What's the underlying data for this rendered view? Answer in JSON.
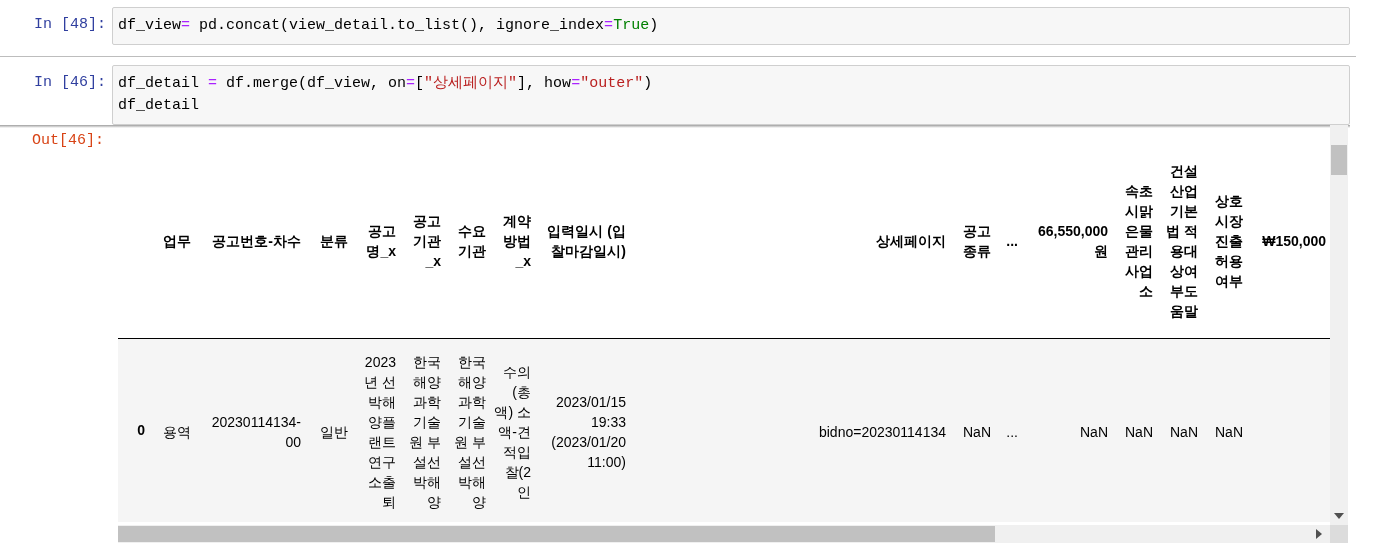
{
  "cells": [
    {
      "prompt": "In [48]:",
      "lines": [
        [
          {
            "kind": "plain",
            "text": "df_view"
          },
          {
            "kind": "operator",
            "text": "="
          },
          {
            "kind": "plain",
            "text": " pd.concat(view_detail.to_list(), ignore_index"
          },
          {
            "kind": "operator",
            "text": "="
          },
          {
            "kind": "keyword",
            "text": "True"
          },
          {
            "kind": "plain",
            "text": ")"
          }
        ]
      ]
    },
    {
      "prompt": "In [46]:",
      "lines": [
        [
          {
            "kind": "plain",
            "text": "df_detail "
          },
          {
            "kind": "operator",
            "text": "="
          },
          {
            "kind": "plain",
            "text": " df.merge(df_view, on"
          },
          {
            "kind": "operator",
            "text": "="
          },
          {
            "kind": "plain",
            "text": "["
          },
          {
            "kind": "string",
            "text": "\"상세페이지\""
          },
          {
            "kind": "plain",
            "text": "], how"
          },
          {
            "kind": "operator",
            "text": "="
          },
          {
            "kind": "string",
            "text": "\"outer\""
          },
          {
            "kind": "plain",
            "text": ")"
          }
        ],
        [
          {
            "kind": "plain",
            "text": "df_detail"
          }
        ]
      ]
    }
  ],
  "output": {
    "prompt": "Out[46]:",
    "table": {
      "columns": [
        "업무",
        "공고번호-차수",
        "분류",
        "공고명_x",
        "공고기관_x",
        "수요기관",
        "계약방법_x",
        "입력일시 (입찰마감일시)",
        "상세페이지",
        "공고종류",
        "...",
        "66,550,000원",
        "속초시맑은물관리사업소",
        "건설산업기본법 적용대상여부도움말",
        "상호시장진출허용여부",
        "₩150,000"
      ],
      "rows": [
        {
          "index": "0",
          "cells": [
            "용역",
            "20230114134-00",
            "일반",
            "2023년 선박해양플랜트연구소출퇴",
            "한국해양과학기술원 부설선박해양",
            "한국해양과학기술원 부설선박해양",
            "수의(총액) 소액-견적입찰(2인",
            "2023/01/15 19:33 (2023/01/20 11:00)",
            "bidno=20230114134",
            "NaN",
            "...",
            "NaN",
            "NaN",
            "NaN",
            "NaN"
          ]
        }
      ]
    }
  }
}
